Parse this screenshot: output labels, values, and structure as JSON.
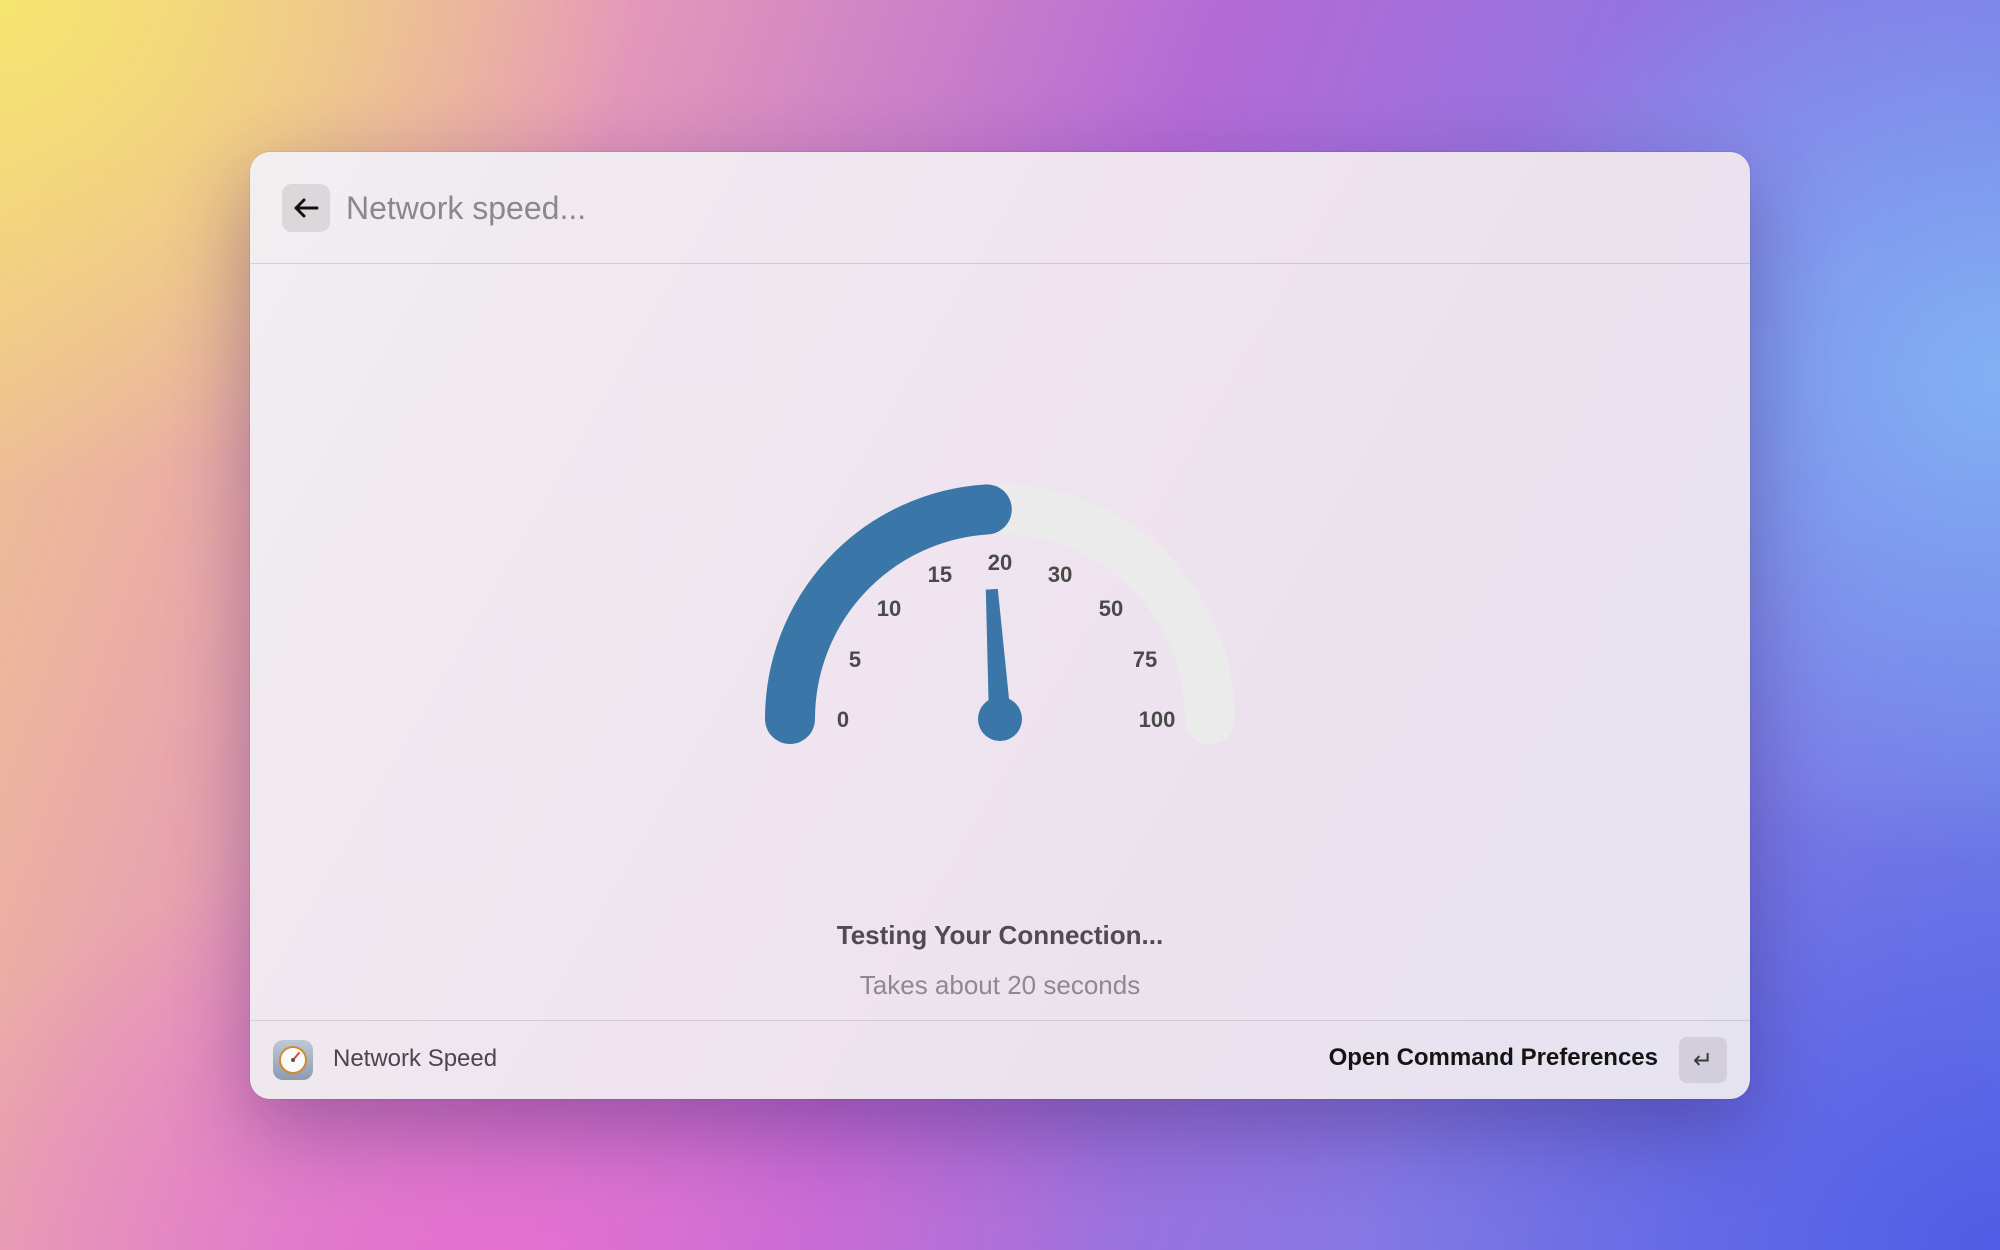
{
  "search": {
    "value": "",
    "placeholder": "Network speed..."
  },
  "gauge": {
    "ticks": [
      "0",
      "5",
      "10",
      "15",
      "20",
      "30",
      "50",
      "75",
      "100"
    ],
    "fill_fraction": 0.48,
    "needle_fraction": 0.48,
    "fill_color": "#3a77a8",
    "track_color": "#ebebeb"
  },
  "status": {
    "title": "Testing Your Connection...",
    "subtitle": "Takes about 20 seconds"
  },
  "footer": {
    "app_name": "Network Speed",
    "action_label": "Open Command Preferences",
    "enter_key": "↵"
  },
  "icons": {
    "back": "arrow-left-icon",
    "app": "speedometer-icon",
    "enter": "return-key-icon"
  }
}
